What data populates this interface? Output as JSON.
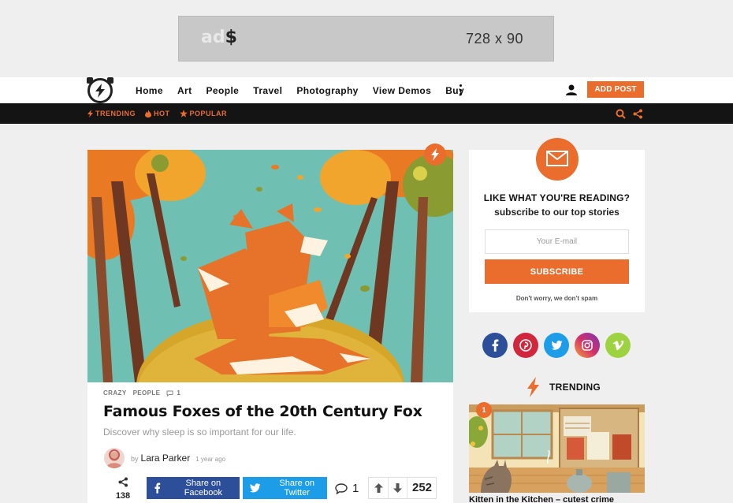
{
  "ad": {
    "logo_prefix": "ad",
    "logo_symbol": "$",
    "size_label": "728 x 90"
  },
  "nav": {
    "items": [
      "Home",
      "Art",
      "People",
      "Travel",
      "Photography",
      "View Demos",
      "Buy"
    ],
    "add_post": "ADD POST"
  },
  "subnav": {
    "trending": "TRENDING",
    "hot": "HOT",
    "popular": "POPULAR"
  },
  "article": {
    "categories": [
      "CRAZY",
      "PEOPLE"
    ],
    "comment_count": "1",
    "title": "Famous Foxes of the 20th Century Fox",
    "subtitle": "Discover why sleep is so important for our life.",
    "by": "by",
    "author": "Lara Parker",
    "time": "1 year ago",
    "share_count": "138",
    "facebook_label": "Share on Facebook",
    "twitter_label": "Share on Twitter",
    "comments": "1",
    "votes": "252"
  },
  "newsletter": {
    "title": "LIKE WHAT YOU'RE READING?",
    "subtitle": "subscribe to our top stories",
    "placeholder": "Your E-mail",
    "button": "SUBSCRIBE",
    "note": "Don't worry, we don't spam"
  },
  "social": [
    {
      "icon": "facebook-icon",
      "color": "#2d4e99"
    },
    {
      "icon": "pinterest-icon",
      "color": "#d0273d"
    },
    {
      "icon": "twitter-icon",
      "color": "#1d9de8"
    },
    {
      "icon": "instagram-icon",
      "color": "#c8338a"
    },
    {
      "icon": "vimeo-icon",
      "color": "#9dd341"
    }
  ],
  "trending": {
    "heading": "TRENDING",
    "rank": "1",
    "title": "Kitten in the Kitchen – cutest crime"
  },
  "colors": {
    "accent": "#ea6d2e",
    "dark_bar": "#141414"
  }
}
